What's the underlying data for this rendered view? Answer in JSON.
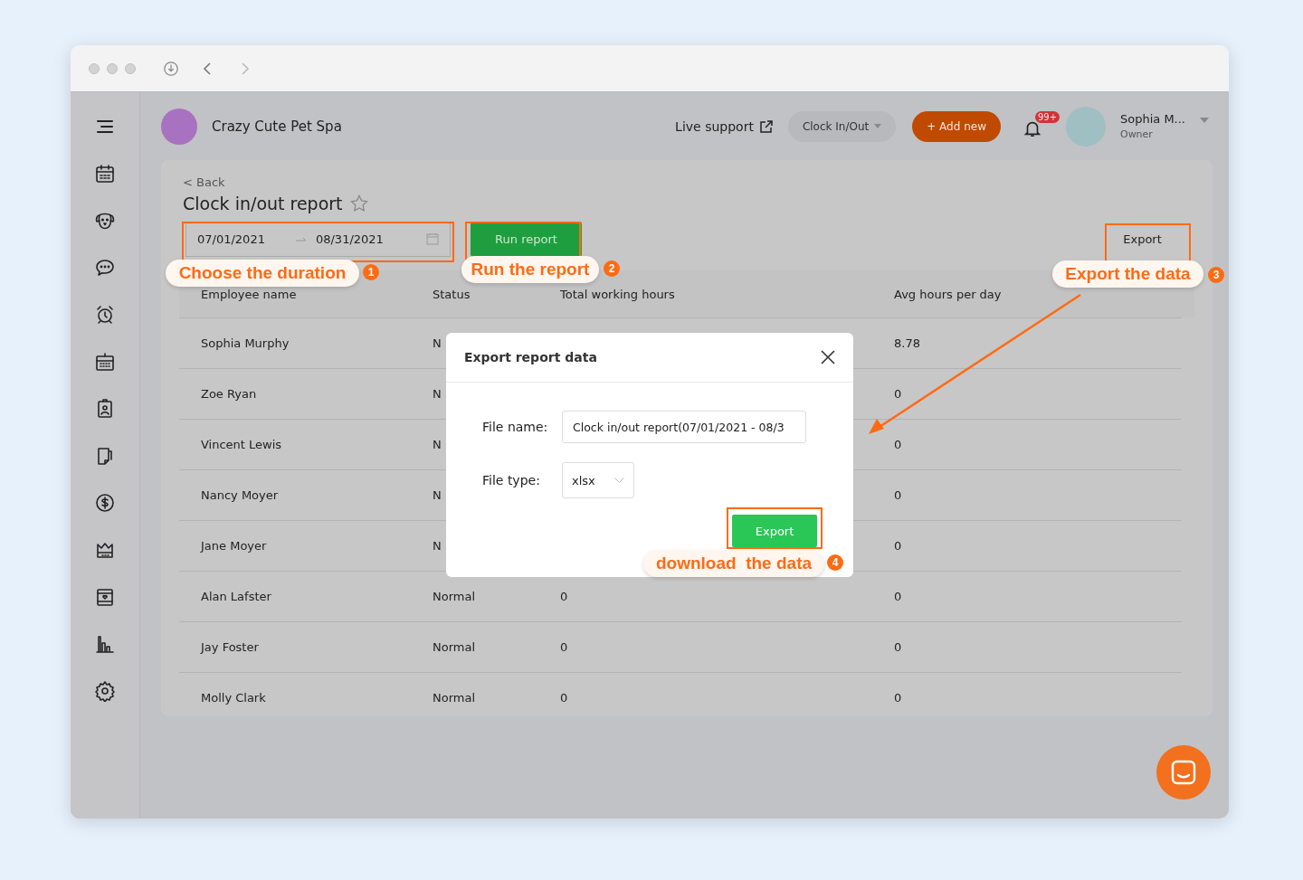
{
  "header": {
    "brand": "Crazy Cute Pet Spa",
    "live_support": "Live support",
    "clock_dropdown": "Clock In/Out",
    "add_button": "+ Add new",
    "notification_count": "99+",
    "user_name": "Sophia M...",
    "user_role": "Owner"
  },
  "report": {
    "back": "< Back",
    "title": "Clock in/out report",
    "starred": false,
    "date_start": "07/01/2021",
    "date_end": "08/31/2021",
    "run_button": "Run report",
    "export_button": "Export"
  },
  "table": {
    "columns": [
      "Employee name",
      "Status",
      "Total working hours",
      "Avg hours per day"
    ],
    "rows": [
      {
        "name": "Sophia Murphy",
        "status": "N",
        "avg": "8.78"
      },
      {
        "name": "Zoe Ryan",
        "status": "N",
        "avg": "0"
      },
      {
        "name": "Vincent Lewis",
        "status": "N",
        "avg": "0"
      },
      {
        "name": "Nancy Moyer",
        "status": "N",
        "avg": "0"
      },
      {
        "name": "Jane Moyer",
        "status": "N",
        "avg": "0"
      },
      {
        "name": "Alan Lafster",
        "status": "Normal",
        "total": "0",
        "avg": "0"
      },
      {
        "name": "Jay Foster",
        "status": "Normal",
        "total": "0",
        "avg": "0"
      },
      {
        "name": "Molly Clark",
        "status": "Normal",
        "total": "0",
        "avg": "0"
      }
    ]
  },
  "modal": {
    "title": "Export report data",
    "file_name_label": "File name:",
    "file_name_value": "Clock in/out report(07/01/2021 - 08/3",
    "file_type_label": "File type:",
    "file_type_value": "xlsx",
    "export_button": "Export"
  },
  "annotations": [
    {
      "text": "Choose the duration",
      "number": "1"
    },
    {
      "text": "Run the report",
      "number": "2"
    },
    {
      "text": "Export the data",
      "number": "3"
    },
    {
      "text": "download  the data",
      "number": "4"
    }
  ]
}
